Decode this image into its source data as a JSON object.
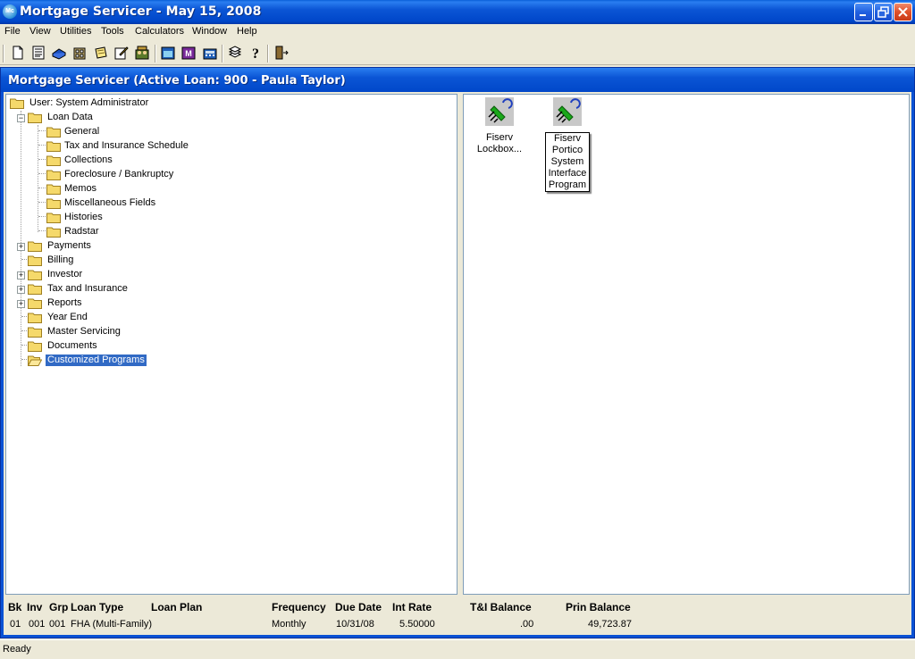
{
  "app": {
    "title": "Mortgage Servicer  -  May 15, 2008",
    "icon_text": "Mc"
  },
  "menu": [
    "File",
    "View",
    "Utilities",
    "Tools",
    "Calculators",
    "Window",
    "Help"
  ],
  "toolbar_icons": [
    "new-icon",
    "document-icon",
    "book-icon",
    "building-icon",
    "notepad-icon",
    "edit-icon",
    "people-icon",
    "fiserv-icon",
    "mail-icon",
    "calculator-icon",
    "stack-icon",
    "help-icon",
    "exit-icon"
  ],
  "child_window": {
    "title": "Mortgage Servicer (Active Loan: 900 - Paula Taylor)"
  },
  "tree": {
    "root": "User: System Administrator",
    "loan_data": "Loan Data",
    "loan_data_children": [
      "General",
      "Tax and Insurance Schedule",
      "Collections",
      "Foreclosure / Bankruptcy",
      "Memos",
      "Miscellaneous Fields",
      "Histories",
      "Radstar"
    ],
    "items": [
      "Payments",
      "Billing",
      "Investor",
      "Tax and Insurance",
      "Reports",
      "Year End",
      "Master Servicing",
      "Documents",
      "Customized Programs"
    ],
    "expandable": [
      "Payments",
      "Investor",
      "Tax and Insurance",
      "Reports"
    ],
    "selected": "Customized Programs"
  },
  "programs": [
    {
      "lines": [
        "Fiserv",
        "Lockbox..."
      ]
    },
    {
      "lines": [
        "Fiserv",
        "Portico",
        "System",
        "Interface",
        "Program"
      ]
    }
  ],
  "loan_info": {
    "headers": {
      "bk": "Bk",
      "inv": "Inv",
      "grp": "Grp",
      "loan_type": "Loan Type",
      "loan_plan": "Loan Plan",
      "frequency": "Frequency",
      "due_date": "Due Date",
      "int_rate": "Int Rate",
      "ti_balance": "T&I Balance",
      "prin_balance": "Prin Balance"
    },
    "values": {
      "bk": "01",
      "inv": "001",
      "grp": "001",
      "loan_type": "FHA (Multi-Family)",
      "loan_plan": "",
      "frequency": "Monthly",
      "due_date": "10/31/08",
      "int_rate": "5.50000",
      "ti_balance": ".00",
      "prin_balance": "49,723.87"
    }
  },
  "status": "Ready",
  "colors": {
    "title_blue": "#0047c9",
    "selection": "#316ac5",
    "face": "#ece9d8",
    "close_red": "#e0502a"
  }
}
